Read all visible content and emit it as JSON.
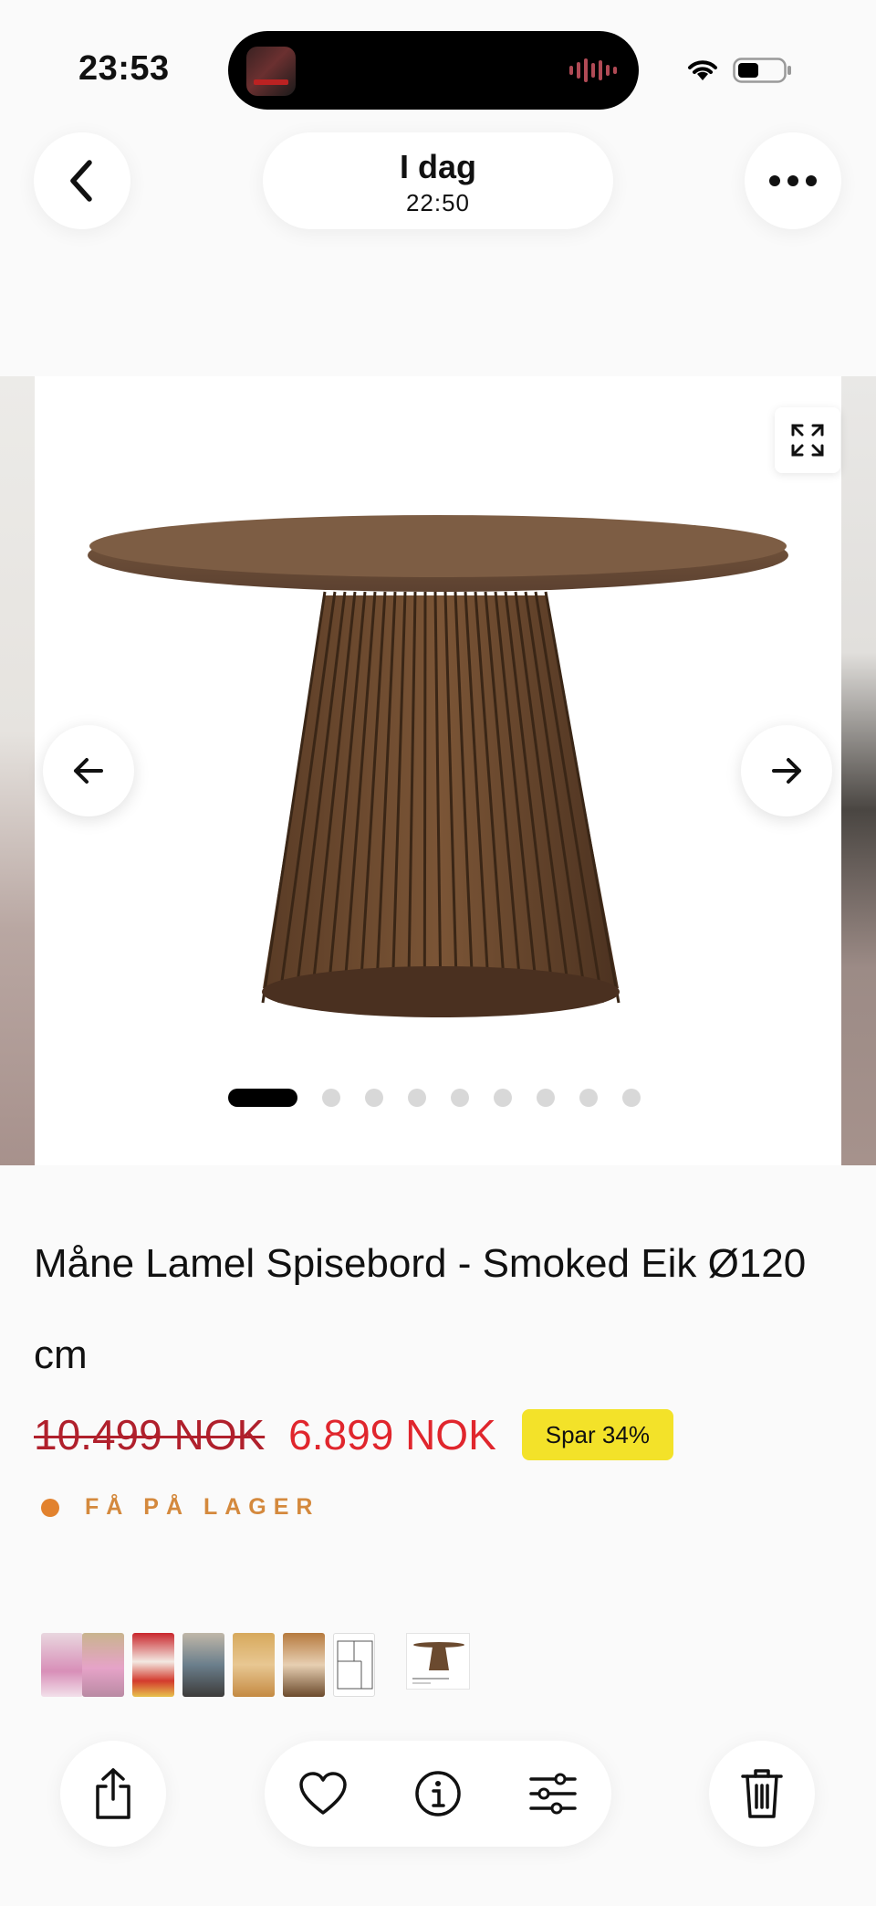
{
  "status_bar": {
    "time": "23:53",
    "icons": [
      "now-playing-art",
      "audio-waveform-icon",
      "wifi-icon",
      "battery-icon"
    ]
  },
  "header": {
    "title": "I dag",
    "subtitle": "22:50",
    "icons": [
      "chevron-left-icon",
      "more-dots-icon"
    ]
  },
  "photo_viewer": {
    "page_count": 9,
    "active_index": 0,
    "icons": [
      "expand-icon",
      "arrow-left-icon",
      "arrow-right-icon"
    ]
  },
  "product": {
    "title": "Måne Lamel Spisebord - Smoked Eik Ø120 cm",
    "old_price": "10.499 NOK",
    "new_price": "6.899 NOK",
    "save_badge": "Spar 34%",
    "stock": "FÅ PÅ LAGER"
  },
  "colors": {
    "price_red": "#e0262d",
    "badge_yellow": "#f3e229",
    "stock_orange": "#e2822e",
    "wood": "#6b4a2f"
  },
  "thumbnails": [
    "photo-thumb-1",
    "photo-thumb-2",
    "photo-thumb-3",
    "photo-thumb-4",
    "photo-thumb-5",
    "photo-thumb-6",
    "floorplan-thumb",
    "product-page-thumb"
  ],
  "toolbar": {
    "icons": [
      "share-icon",
      "heart-icon",
      "info-icon",
      "sliders-icon",
      "trash-icon"
    ]
  }
}
